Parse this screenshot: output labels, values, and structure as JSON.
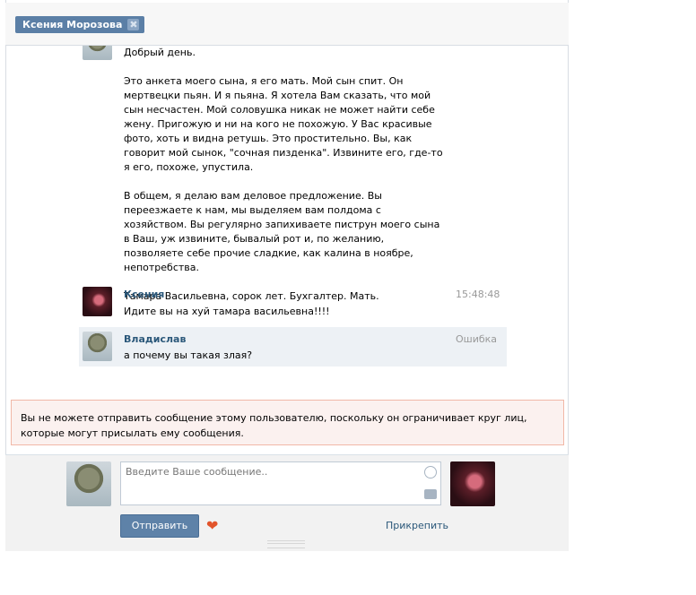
{
  "tab": {
    "name": "Ксения Морозова",
    "close": "✖"
  },
  "messages": {
    "first": {
      "paragraphs": [
        "Добрый день.",
        "Это анкета моего сына, я его мать. Мой сын спит. Он мертвецки пьян. И я пьяна. Я хотела Вам сказать, что мой сын несчастен. Мой соловушка никак не может найти себе жену. Пригожую и ни на кого не похожую. У Вас красивые фото, хоть и видна ретушь. Это простительно. Вы, как говорит мой сынок, \"сочная пизденка\". Извините его, где-то я его, похоже, упустила.",
        "В общем, я делаю вам деловое предложение. Вы переезжаете к нам, мы выделяем вам полдома с хозяйством. Вы регулярно запихиваете пиструн моего сына в Ваш, уж извините, бывалый рот и, по желанию, позволяете себе прочие сладкие, как калина в ноябре, непотребства.",
        "Тамара Васильевна, сорок лет. Бухгалтер. Мать."
      ]
    },
    "second": {
      "author": "Ксения",
      "time": "15:48:48",
      "text": "Идите вы на хуй тамара васильевна!!!!"
    },
    "third": {
      "author": "Владислав",
      "time": "Ошибка",
      "text": "а почему вы такая злая?"
    }
  },
  "warning": "Вы не можете отправить сообщение этому пользователю, поскольку он ограничивает круг лиц, которые могут присылать ему сообщения.",
  "composer": {
    "placeholder": "Введите Ваше сообщение..",
    "send_label": "Отправить",
    "attach_label": "Прикрепить",
    "heart": "❤"
  },
  "colors": {
    "accent": "#5e82a8",
    "link": "#2b587a",
    "warning_bg": "#fbf1ef",
    "warning_border": "#f1b8a7"
  }
}
